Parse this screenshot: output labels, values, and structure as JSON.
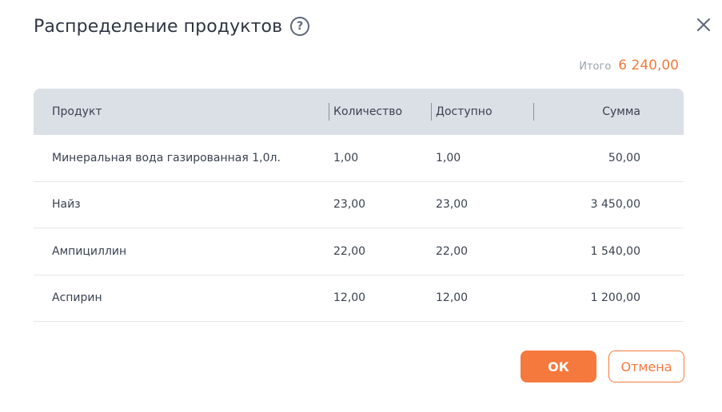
{
  "dialog": {
    "title": "Распределение продуктов",
    "help_icon": "question-circle-icon",
    "close_icon": "close-x-icon"
  },
  "total": {
    "label": "Итого",
    "value": "6 240,00"
  },
  "table": {
    "headers": {
      "product": "Продукт",
      "quantity": "Количество",
      "available": "Доступно",
      "sum": "Сумма"
    },
    "rows": [
      {
        "product": "Минеральная вода газированная 1,0л.",
        "quantity": "1,00",
        "available": "1,00",
        "sum": "50,00"
      },
      {
        "product": "Найз",
        "quantity": "23,00",
        "available": "23,00",
        "sum": "3 450,00"
      },
      {
        "product": "Ампициллин",
        "quantity": "22,00",
        "available": "22,00",
        "sum": "1 540,00"
      },
      {
        "product": "Аспирин",
        "quantity": "12,00",
        "available": "12,00",
        "sum": "1 200,00"
      }
    ]
  },
  "buttons": {
    "ok": "ОК",
    "cancel": "Отмена"
  },
  "colors": {
    "accent": "#f5793d",
    "header_bg": "#dbdfe6"
  }
}
